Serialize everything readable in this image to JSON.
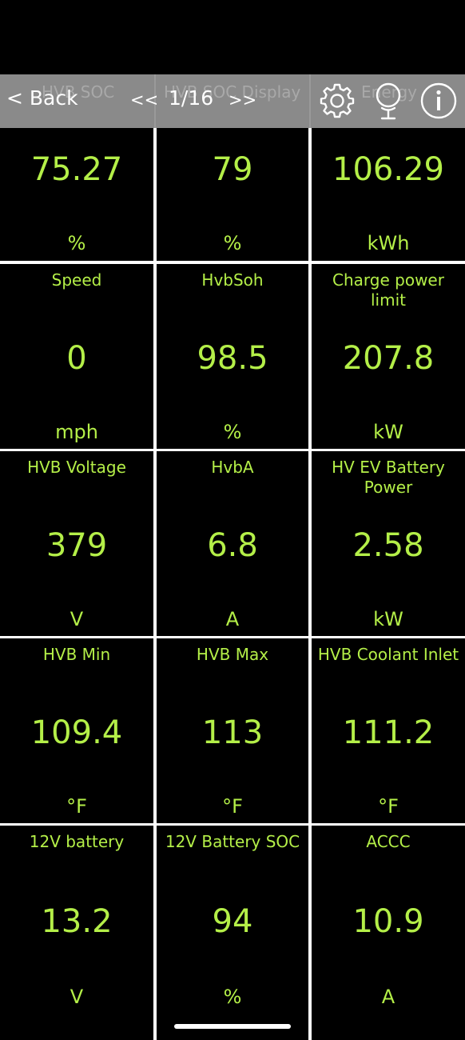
{
  "toolbar": {
    "back_label": "< Back",
    "ghost_titles": [
      "HVB SOC",
      "HVB SOC Display",
      "Energy"
    ],
    "prev_label": "<<",
    "page_indicator": "1/16",
    "next_label": ">>",
    "icons": [
      "gear-icon",
      "microphone-icon",
      "info-icon"
    ]
  },
  "cells": [
    {
      "name": "",
      "value": "75.27",
      "unit": "%"
    },
    {
      "name": "",
      "value": "79",
      "unit": "%"
    },
    {
      "name": "",
      "value": "106.29",
      "unit": "kWh"
    },
    {
      "name": "Speed",
      "value": "0",
      "unit": "mph"
    },
    {
      "name": "HvbSoh",
      "value": "98.5",
      "unit": "%"
    },
    {
      "name": "Charge power limit",
      "value": "207.8",
      "unit": "kW"
    },
    {
      "name": "HVB Voltage",
      "value": "379",
      "unit": "V"
    },
    {
      "name": "HvbA",
      "value": "6.8",
      "unit": "A"
    },
    {
      "name": "HV EV Battery Power",
      "value": "2.58",
      "unit": "kW"
    },
    {
      "name": "HVB Min",
      "value": "109.4",
      "unit": "°F"
    },
    {
      "name": "HVB Max",
      "value": "113",
      "unit": "°F"
    },
    {
      "name": "HVB Coolant Inlet",
      "value": "111.2",
      "unit": "°F"
    },
    {
      "name": "12V battery",
      "value": "13.2",
      "unit": "V"
    },
    {
      "name": "12V Battery SOC",
      "value": "94",
      "unit": "%"
    },
    {
      "name": "ACCC",
      "value": "10.9",
      "unit": "A"
    }
  ],
  "colors": {
    "value_text": "#b4ef48",
    "toolbar_bg": "#8a8a8a",
    "cell_bg": "#000000",
    "grid_lines": "#ffffff"
  }
}
